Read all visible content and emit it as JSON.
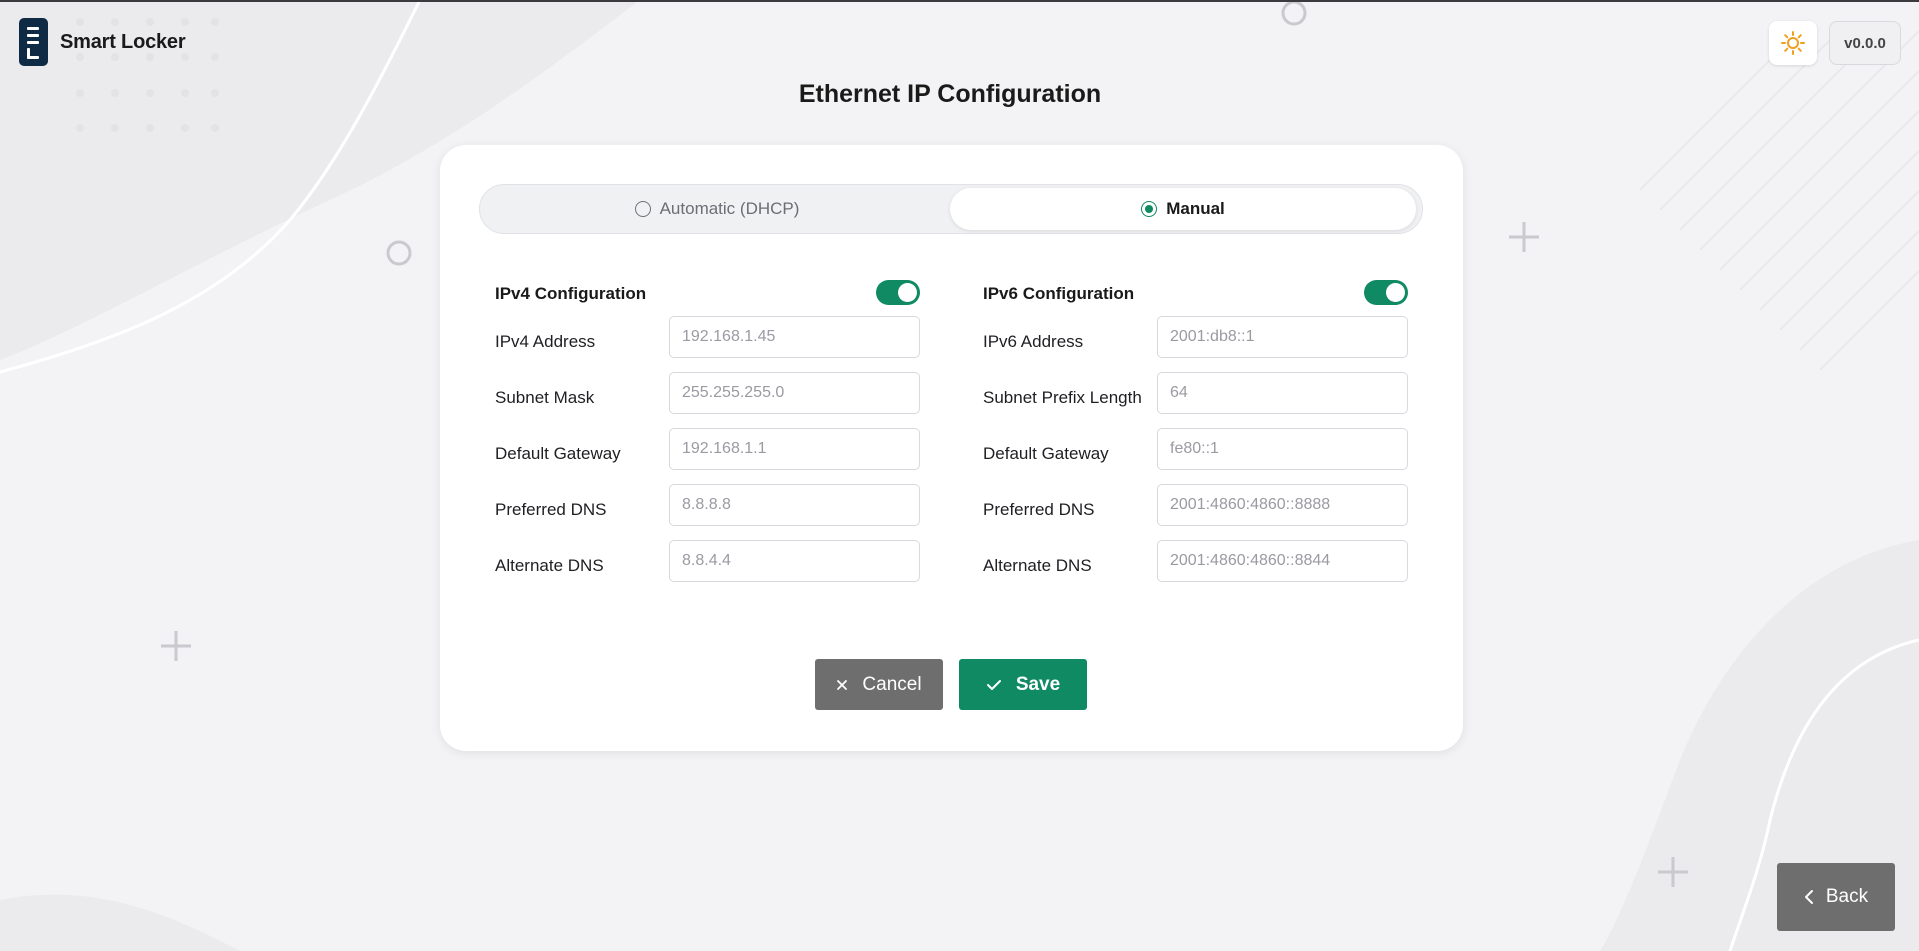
{
  "app": {
    "name": "Smart Locker",
    "version": "v0.0.0"
  },
  "page": {
    "title": "Ethernet IP Configuration"
  },
  "mode": {
    "options": [
      {
        "label": "Automatic (DHCP)",
        "selected": false
      },
      {
        "label": "Manual",
        "selected": true
      }
    ]
  },
  "ipv4": {
    "title": "IPv4 Configuration",
    "enabled": true,
    "fields": [
      {
        "label": "IPv4 Address",
        "placeholder": "192.168.1.45"
      },
      {
        "label": "Subnet Mask",
        "placeholder": "255.255.255.0"
      },
      {
        "label": "Default Gateway",
        "placeholder": "192.168.1.1"
      },
      {
        "label": "Preferred DNS",
        "placeholder": "8.8.8.8"
      },
      {
        "label": "Alternate DNS",
        "placeholder": "8.8.4.4"
      }
    ]
  },
  "ipv6": {
    "title": "IPv6 Configuration",
    "enabled": true,
    "fields": [
      {
        "label": "IPv6 Address",
        "placeholder": "2001:db8::1"
      },
      {
        "label": "Subnet Prefix Length",
        "placeholder": "64"
      },
      {
        "label": "Default Gateway",
        "placeholder": "fe80::1"
      },
      {
        "label": "Preferred DNS",
        "placeholder": "2001:4860:4860::8888"
      },
      {
        "label": "Alternate DNS",
        "placeholder": "2001:4860:4860::8844"
      }
    ]
  },
  "actions": {
    "cancel": "Cancel",
    "save": "Save",
    "back": "Back"
  },
  "icons": {
    "theme": "sun-icon",
    "cancel": "close-icon",
    "save": "check-icon",
    "back": "chevron-left-icon"
  },
  "colors": {
    "accent": "#0f8a63",
    "neutral_button": "#6e6e6e",
    "brand": "#0f2a44",
    "sun": "#f0a020"
  }
}
